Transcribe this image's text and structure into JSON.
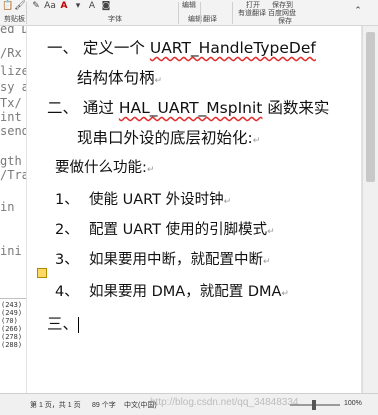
{
  "ribbon": {
    "clipboard_label": "剪贴板",
    "font_label": "字体",
    "edit_label": "编辑",
    "open_label": "打开",
    "open_cloud_label": "有道翻译",
    "save_label": "保存到",
    "save_cloud_label": "百度网盘",
    "save_group_label": "保存",
    "translate_label": "翻译",
    "font_color_glyph": "A"
  },
  "code_bg": {
    "lines": [
      "rfac",
      "ed D",
      "",
      "/Rx",
      "lize",
      "sy a",
      "Tx/",
      "int",
      "send",
      "",
      "gth",
      "/Tra",
      "",
      "in",
      "",
      "",
      "ini"
    ],
    "right_lines": [
      "",
      "",
      "",
      "",
      "",
      "",
      "",
      "h",
      "h"
    ]
  },
  "ide_panel": {
    "lines": [
      "(243)",
      "(249)",
      "(70)",
      "(266)",
      "(278)",
      "(288)",
      "",
      "",
      "",
      "",
      "",
      ""
    ]
  },
  "document": {
    "heading1_prefix": "一、 定义一个 ",
    "heading1_code": "UART_HandleTypeDef",
    "heading1_line2": "结构体句柄",
    "heading2_prefix": "二、 通过 ",
    "heading2_code": "HAL_UART_MspInit",
    "heading2_suffix": " 函数来实",
    "heading2_line2": "现串口外设的底层初始化:",
    "question": "要做什么功能:",
    "items": [
      {
        "num": "1、",
        "text": "使能 UART 外设时钟"
      },
      {
        "num": "2、",
        "text": "配置 UART 使用的引脚模式"
      },
      {
        "num": "3、",
        "text": "如果要用中断，就配置中断"
      },
      {
        "num": "4、",
        "text": "如果要用 DMA，就配置 DMA"
      }
    ],
    "heading3": "三、",
    "para_mark": "↵"
  },
  "statusbar": {
    "page": "第 1 页，共 1 页",
    "words": "89 个字",
    "lang": "中文(中国)",
    "watermark": "http://blog.csdn.net/qq_34848334",
    "zoom": "100%"
  }
}
